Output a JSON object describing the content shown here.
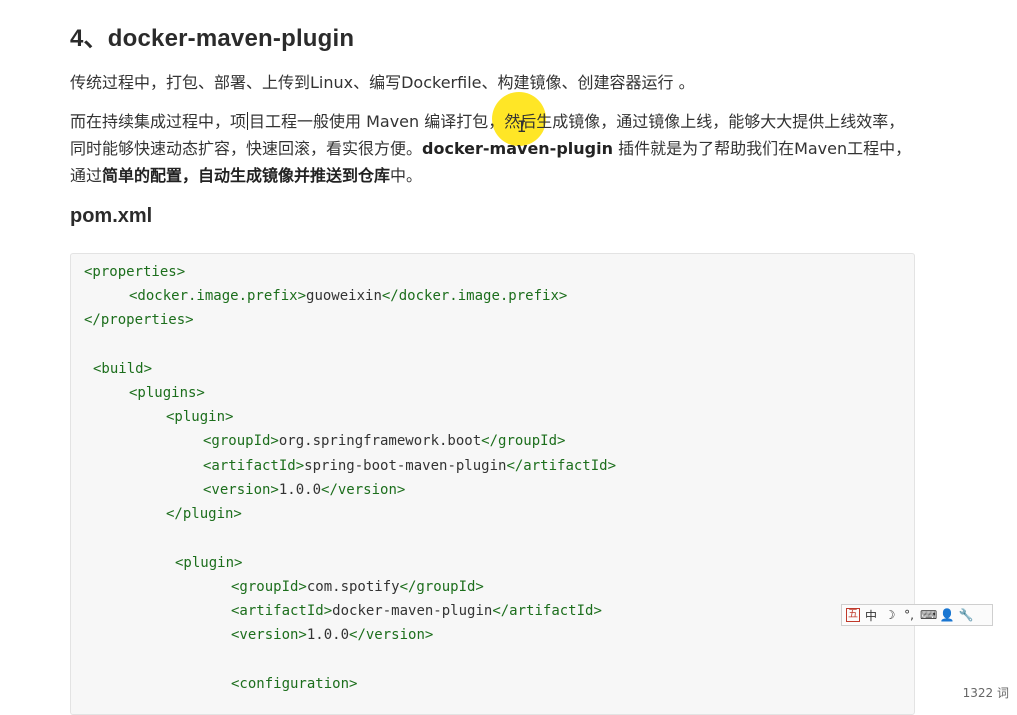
{
  "heading": "4、docker-maven-plugin",
  "p1": "传统过程中，打包、部署、上传到Linux、编写Dockerfile、构建镜像、创建容器运行 。",
  "p2": {
    "part1a": "而在持续集成过程中，项",
    "part1b": "目工程一般使用 Maven 编译打包，然后生成镜像，通过镜像上线，能够大大提供上线效率，同时能够快速动态扩容，快速回滚，看实很方便。",
    "bold1": "docker-maven-plugin",
    "part2": " 插件就是为了帮助我们在Maven工程中，通过",
    "bold2": "简单的配置，自动生成镜像并推送到仓库",
    "part3": "中。"
  },
  "subheading": "pom.xml",
  "code": {
    "l1_open": "<properties>",
    "l2_open": "<docker.image.prefix>",
    "l2_val": "guoweixin",
    "l2_close": "</docker.image.prefix>",
    "l3_close": "</properties>",
    "l5_open": "<build>",
    "l6_open": "<plugins>",
    "l7_open": "<plugin>",
    "l8_open": "<groupId>",
    "l8_val": "org.springframework.boot",
    "l8_close": "</groupId>",
    "l9_open": "<artifactId>",
    "l9_val": "spring-boot-maven-plugin",
    "l9_close": "</artifactId>",
    "l10_open": "<version>",
    "l10_val": "1.0.0",
    "l10_close": "</version>",
    "l11_close": "</plugin>",
    "l13_open": "<plugin>",
    "l14_open": "<groupId>",
    "l14_val": "com.spotify",
    "l14_close": "</groupId>",
    "l15_open": "<artifactId>",
    "l15_val": "docker-maven-plugin",
    "l15_close": "</artifactId>",
    "l16_open": "<version>",
    "l16_val": "1.0.0",
    "l16_close": "</version>",
    "l18_open": "<configuration>"
  },
  "ime_toolbar": {
    "mode_label": "中",
    "icons": [
      "ime-logo-icon",
      "moon-icon",
      "punctuation-icon",
      "keyboard-icon",
      "user-icon",
      "wrench-icon"
    ]
  },
  "word_count": "1322 词",
  "colors": {
    "tag": "#1c6e1c",
    "highlight": "#ffe200",
    "code_bg": "#f7f7f7"
  }
}
